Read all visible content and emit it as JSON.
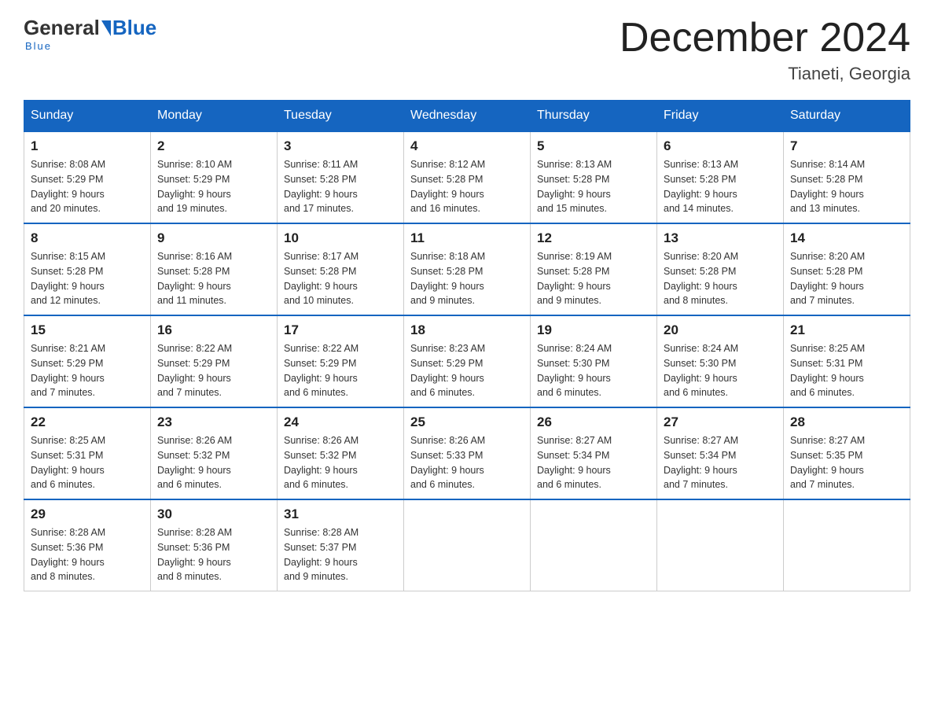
{
  "logo": {
    "general": "General",
    "blue": "Blue",
    "tagline": "Blue"
  },
  "title": {
    "month_year": "December 2024",
    "location": "Tianeti, Georgia"
  },
  "weekdays": [
    "Sunday",
    "Monday",
    "Tuesday",
    "Wednesday",
    "Thursday",
    "Friday",
    "Saturday"
  ],
  "weeks": [
    [
      {
        "day": "1",
        "sunrise": "8:08 AM",
        "sunset": "5:29 PM",
        "daylight": "9 hours and 20 minutes."
      },
      {
        "day": "2",
        "sunrise": "8:10 AM",
        "sunset": "5:29 PM",
        "daylight": "9 hours and 19 minutes."
      },
      {
        "day": "3",
        "sunrise": "8:11 AM",
        "sunset": "5:28 PM",
        "daylight": "9 hours and 17 minutes."
      },
      {
        "day": "4",
        "sunrise": "8:12 AM",
        "sunset": "5:28 PM",
        "daylight": "9 hours and 16 minutes."
      },
      {
        "day": "5",
        "sunrise": "8:13 AM",
        "sunset": "5:28 PM",
        "daylight": "9 hours and 15 minutes."
      },
      {
        "day": "6",
        "sunrise": "8:13 AM",
        "sunset": "5:28 PM",
        "daylight": "9 hours and 14 minutes."
      },
      {
        "day": "7",
        "sunrise": "8:14 AM",
        "sunset": "5:28 PM",
        "daylight": "9 hours and 13 minutes."
      }
    ],
    [
      {
        "day": "8",
        "sunrise": "8:15 AM",
        "sunset": "5:28 PM",
        "daylight": "9 hours and 12 minutes."
      },
      {
        "day": "9",
        "sunrise": "8:16 AM",
        "sunset": "5:28 PM",
        "daylight": "9 hours and 11 minutes."
      },
      {
        "day": "10",
        "sunrise": "8:17 AM",
        "sunset": "5:28 PM",
        "daylight": "9 hours and 10 minutes."
      },
      {
        "day": "11",
        "sunrise": "8:18 AM",
        "sunset": "5:28 PM",
        "daylight": "9 hours and 9 minutes."
      },
      {
        "day": "12",
        "sunrise": "8:19 AM",
        "sunset": "5:28 PM",
        "daylight": "9 hours and 9 minutes."
      },
      {
        "day": "13",
        "sunrise": "8:20 AM",
        "sunset": "5:28 PM",
        "daylight": "9 hours and 8 minutes."
      },
      {
        "day": "14",
        "sunrise": "8:20 AM",
        "sunset": "5:28 PM",
        "daylight": "9 hours and 7 minutes."
      }
    ],
    [
      {
        "day": "15",
        "sunrise": "8:21 AM",
        "sunset": "5:29 PM",
        "daylight": "9 hours and 7 minutes."
      },
      {
        "day": "16",
        "sunrise": "8:22 AM",
        "sunset": "5:29 PM",
        "daylight": "9 hours and 7 minutes."
      },
      {
        "day": "17",
        "sunrise": "8:22 AM",
        "sunset": "5:29 PM",
        "daylight": "9 hours and 6 minutes."
      },
      {
        "day": "18",
        "sunrise": "8:23 AM",
        "sunset": "5:29 PM",
        "daylight": "9 hours and 6 minutes."
      },
      {
        "day": "19",
        "sunrise": "8:24 AM",
        "sunset": "5:30 PM",
        "daylight": "9 hours and 6 minutes."
      },
      {
        "day": "20",
        "sunrise": "8:24 AM",
        "sunset": "5:30 PM",
        "daylight": "9 hours and 6 minutes."
      },
      {
        "day": "21",
        "sunrise": "8:25 AM",
        "sunset": "5:31 PM",
        "daylight": "9 hours and 6 minutes."
      }
    ],
    [
      {
        "day": "22",
        "sunrise": "8:25 AM",
        "sunset": "5:31 PM",
        "daylight": "9 hours and 6 minutes."
      },
      {
        "day": "23",
        "sunrise": "8:26 AM",
        "sunset": "5:32 PM",
        "daylight": "9 hours and 6 minutes."
      },
      {
        "day": "24",
        "sunrise": "8:26 AM",
        "sunset": "5:32 PM",
        "daylight": "9 hours and 6 minutes."
      },
      {
        "day": "25",
        "sunrise": "8:26 AM",
        "sunset": "5:33 PM",
        "daylight": "9 hours and 6 minutes."
      },
      {
        "day": "26",
        "sunrise": "8:27 AM",
        "sunset": "5:34 PM",
        "daylight": "9 hours and 6 minutes."
      },
      {
        "day": "27",
        "sunrise": "8:27 AM",
        "sunset": "5:34 PM",
        "daylight": "9 hours and 7 minutes."
      },
      {
        "day": "28",
        "sunrise": "8:27 AM",
        "sunset": "5:35 PM",
        "daylight": "9 hours and 7 minutes."
      }
    ],
    [
      {
        "day": "29",
        "sunrise": "8:28 AM",
        "sunset": "5:36 PM",
        "daylight": "9 hours and 8 minutes."
      },
      {
        "day": "30",
        "sunrise": "8:28 AM",
        "sunset": "5:36 PM",
        "daylight": "9 hours and 8 minutes."
      },
      {
        "day": "31",
        "sunrise": "8:28 AM",
        "sunset": "5:37 PM",
        "daylight": "9 hours and 9 minutes."
      },
      null,
      null,
      null,
      null
    ]
  ],
  "labels": {
    "sunrise": "Sunrise:",
    "sunset": "Sunset:",
    "daylight": "Daylight:"
  }
}
